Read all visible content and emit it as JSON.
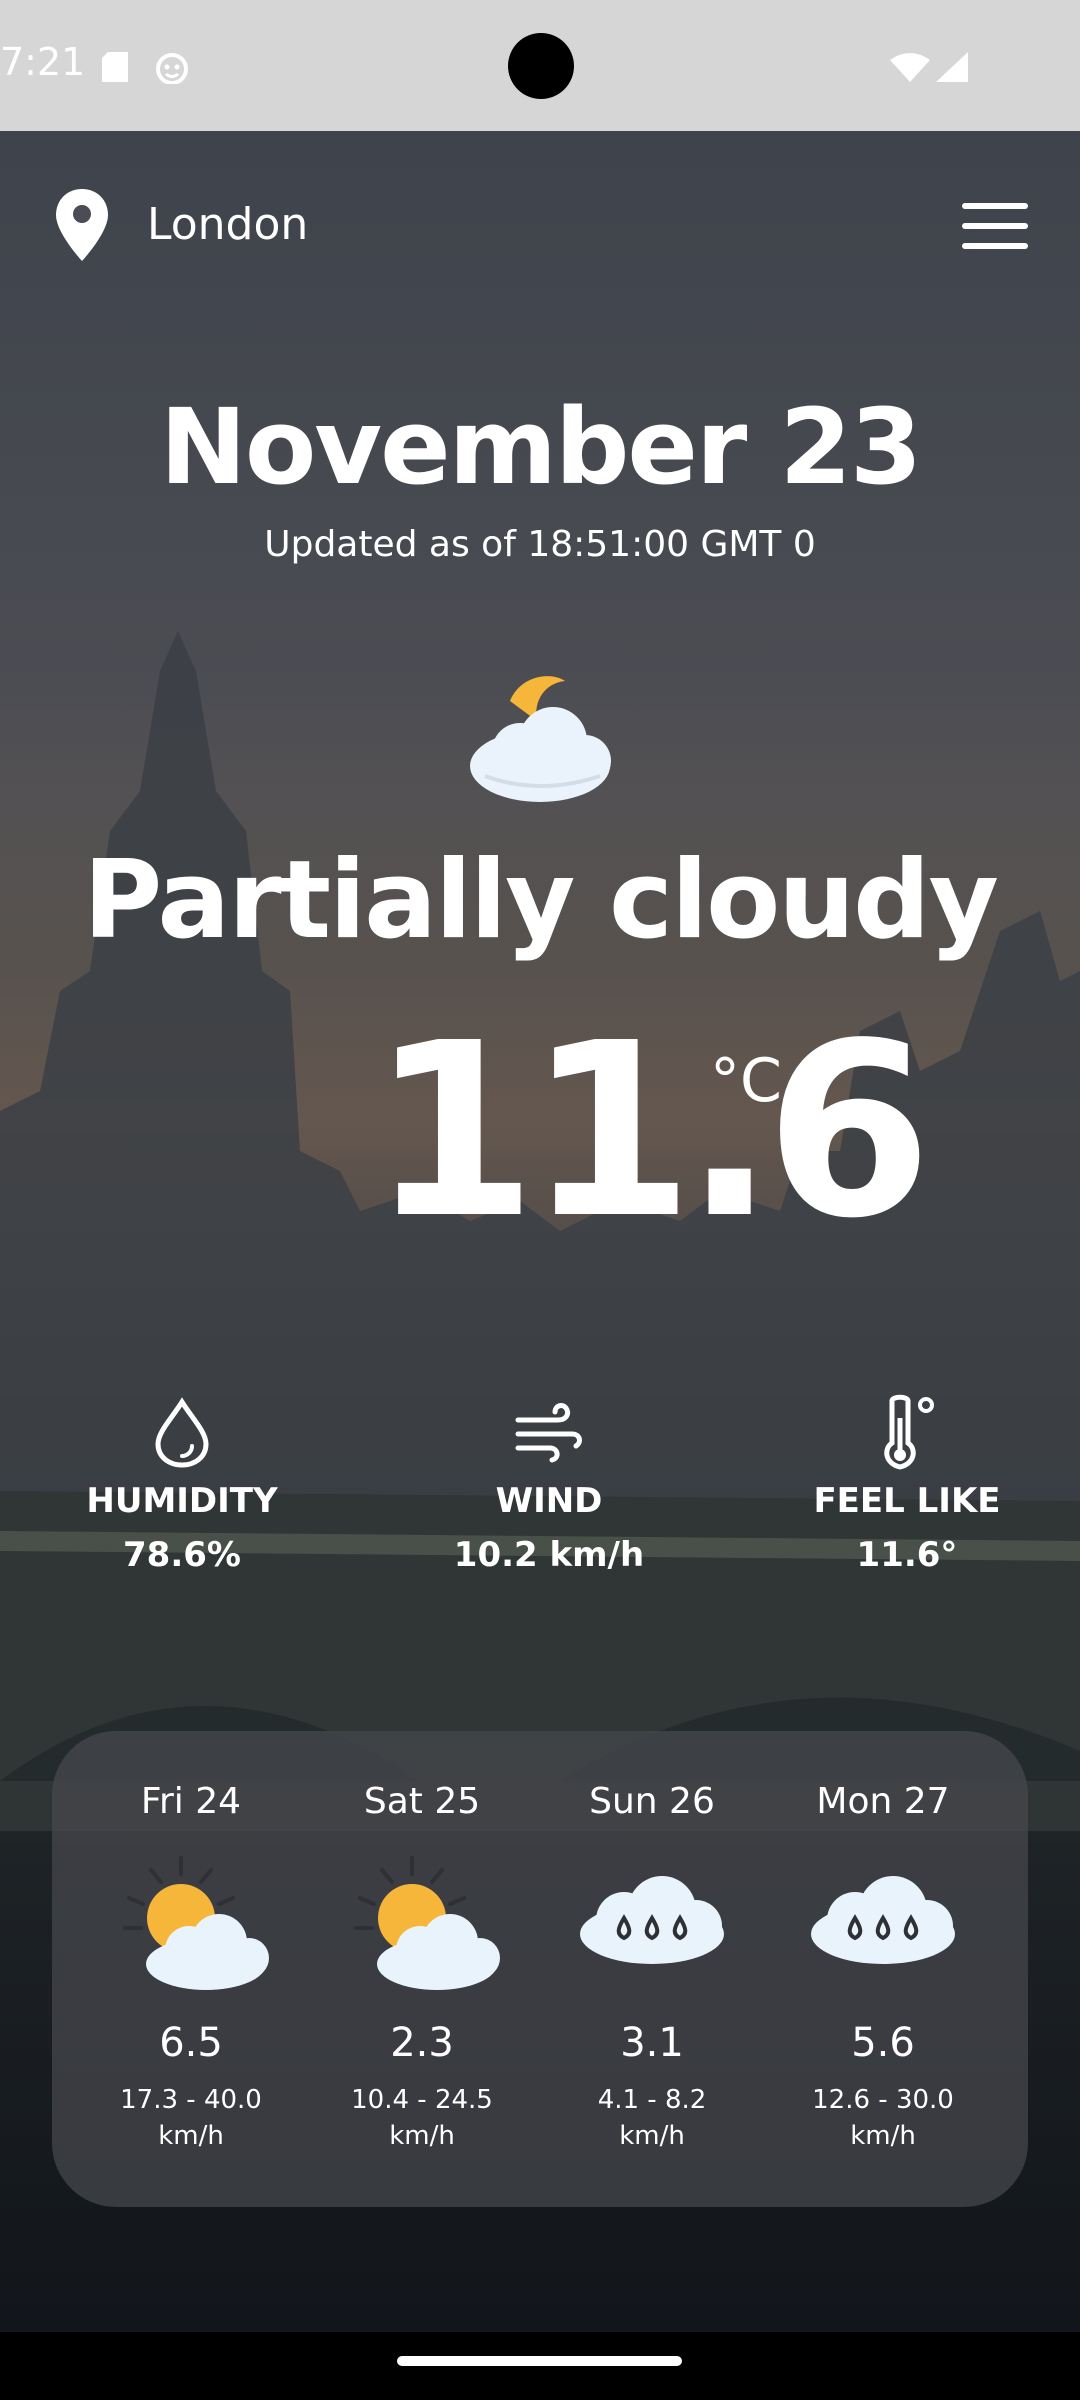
{
  "status_bar": {
    "time": "7:21",
    "icons": [
      "sd-card-icon",
      "notification-app-icon",
      "wifi-icon",
      "signal-icon"
    ]
  },
  "header": {
    "city": "London",
    "location_icon": "map-pin-icon",
    "menu_icon": "hamburger-menu-icon"
  },
  "current": {
    "date": "November 23",
    "updated": "Updated as of  18:51:00 GMT  0",
    "condition_icon": "moon-cloud-icon",
    "condition": "Partially cloudy",
    "temperature": "11.6",
    "unit": "°C"
  },
  "metrics": [
    {
      "icon": "droplet-icon",
      "label": "HUMIDITY",
      "value": "78.6%"
    },
    {
      "icon": "wind-icon",
      "label": "WIND",
      "value": "10.2 km/h"
    },
    {
      "icon": "thermometer-icon",
      "label": "FEEL LIKE",
      "value": "11.6°"
    }
  ],
  "forecast": [
    {
      "day": "Fri 24",
      "icon": "sun-cloud-icon",
      "value": "6.5",
      "range": "17.3 - 40.0",
      "unit": "km/h"
    },
    {
      "day": "Sat 25",
      "icon": "sun-cloud-icon",
      "value": "2.3",
      "range": "10.4 - 24.5",
      "unit": "km/h"
    },
    {
      "day": "Sun 26",
      "icon": "rain-cloud-icon",
      "value": "3.1",
      "range": "4.1 - 8.2",
      "unit": "km/h"
    },
    {
      "day": "Mon 27",
      "icon": "rain-cloud-icon",
      "value": "5.6",
      "range": "12.6 - 30.0",
      "unit": "km/h"
    }
  ],
  "colors": {
    "sun": "#f6b63a",
    "cloud": "#e9f3fb",
    "panel": "#46484e",
    "status_bar": "#d6d6d6"
  }
}
